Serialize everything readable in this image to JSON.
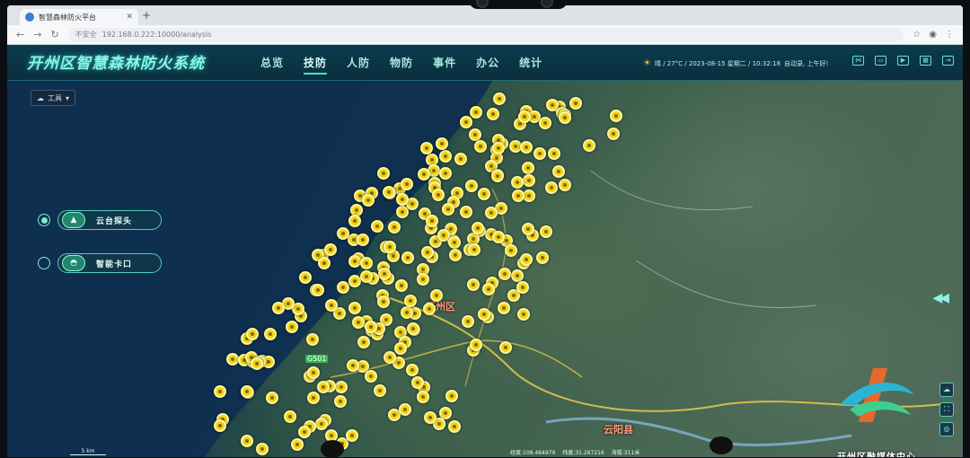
{
  "browser": {
    "tab_title": "智慧森林防火平台",
    "url_warning": "不安全",
    "url": "192.168.0.222:10000/analysis"
  },
  "app": {
    "brand": "开州区智慧森林防火系统",
    "menu": [
      "总览",
      "技防",
      "人防",
      "物防",
      "事件",
      "办公",
      "统计"
    ],
    "active_menu_index": 1,
    "status": {
      "weather": "晴 / 27°C / 2023-08-15 星期二 / 10:32:18",
      "user": "自动录, 上午好!"
    }
  },
  "map": {
    "tools_label": "工具",
    "layers": [
      {
        "label": "云台探头",
        "selected": true
      },
      {
        "label": "智能卡口",
        "selected": false
      }
    ],
    "labels": {
      "center": "开州区",
      "county": "云阳县",
      "road": "G501"
    },
    "scale": "5 km",
    "coords": {
      "lon": "经度:108.464979",
      "lat": "纬度:31.267216",
      "alt": "海拔:311米"
    },
    "watermark": "开州区融媒体中心",
    "colors": {
      "poi": "#f2d31a",
      "accent": "#4fcfbe"
    }
  }
}
